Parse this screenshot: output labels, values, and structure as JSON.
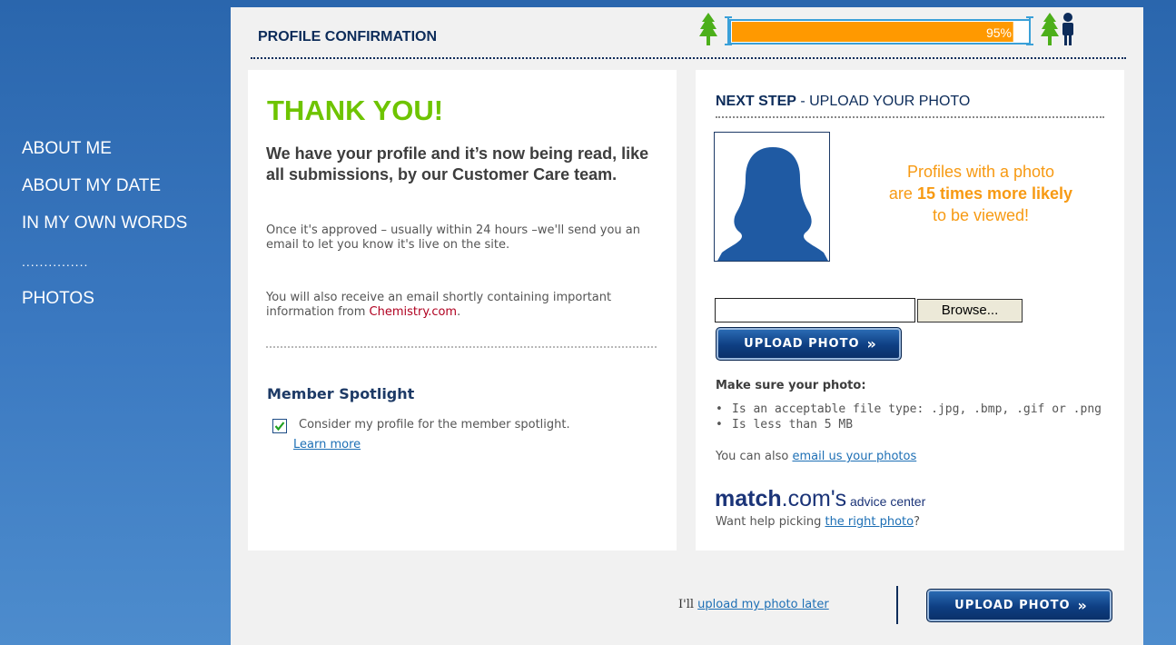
{
  "sidebar": {
    "items": [
      {
        "label": "ABOUT ME"
      },
      {
        "label": "ABOUT MY DATE"
      },
      {
        "label": "IN MY OWN WORDS"
      },
      {
        "label": "PHOTOS"
      }
    ],
    "separator": "..............."
  },
  "header": {
    "title": "PROFILE CONFIRMATION",
    "progress_value": 95,
    "progress_label": "95%"
  },
  "colors": {
    "accent_green": "#6ec400",
    "progress_orange": "#ff9900",
    "brand_navy": "#0d2c5a",
    "promo_orange": "#f79a13"
  },
  "left": {
    "heading": "THANK YOU!",
    "lead": "We have your profile and it’s now being read, like all submissions, by our Customer Care team.",
    "p1": "Once it's approved – usually within 24 hours –we'll send you an email to let you know it's live on the site.",
    "p2_before": "You will also receive an email shortly containing important information from ",
    "p2_brand": "Chemistry.com",
    "p2_after": ".",
    "spotlight_heading": "Member Spotlight",
    "spotlight_checked": true,
    "spotlight_label": "Consider my profile for the member spotlight.",
    "learn_more": "Learn more"
  },
  "right": {
    "next_step_bold": "NEXT STEP",
    "next_step_rest": " - UPLOAD YOUR PHOTO",
    "promo_line1": "Profiles with a photo",
    "promo_line2_pre": "are ",
    "promo_line2_bold": "15 times more likely",
    "promo_line3": "to be viewed!",
    "file_value": "",
    "browse_label": "Browse...",
    "upload_label": "UPLOAD PHOTO",
    "upload_chevron": "»",
    "make_sure": "Make sure your photo:",
    "requirements": [
      "Is an acceptable file type: .jpg, .bmp, .gif or .png",
      "Is less than 5 MB"
    ],
    "also_text": "You can also ",
    "also_link": "email us your photos",
    "logo_match": "match",
    "logo_com": ".com's",
    "logo_adv": " advice center",
    "help_text": "Want help picking ",
    "help_link": "the right photo",
    "help_end": "?"
  },
  "footer": {
    "later_prefix": "I'll ",
    "later_link": "upload my photo later",
    "upload_label": "UPLOAD PHOTO",
    "upload_chevron": "»"
  }
}
